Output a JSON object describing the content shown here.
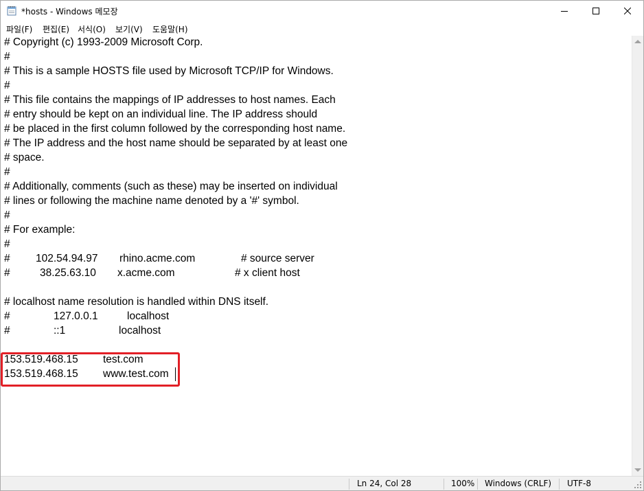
{
  "window": {
    "title": "*hosts - Windows 메모장"
  },
  "menu": [
    "파일(F)",
    "편집(E)",
    "서식(O)",
    "보기(V)",
    "도움말(H)"
  ],
  "editor": {
    "lines": [
      [
        "# Copyright (c) 1993-2009 Microsoft Corp."
      ],
      [
        "#"
      ],
      [
        "# This is a sample HOSTS file used by Microsoft TCP/IP for Windows."
      ],
      [
        "#"
      ],
      [
        "# This file contains the mappings of IP addresses to host names. Each"
      ],
      [
        "# entry should be kept on an individual line. The IP address should"
      ],
      [
        "# be placed in the first column followed by the corresponding host name."
      ],
      [
        "# The IP address and the host name should be separated by at least one"
      ],
      [
        "# space."
      ],
      [
        "#"
      ],
      [
        "# Additionally, comments (such as these) may be inserted on individual"
      ],
      [
        "# lines or following the machine name denoted by a '#' symbol."
      ],
      [
        "#"
      ],
      [
        "# For example:"
      ],
      [
        "#"
      ],
      [
        "#",
        "102.54.94.97",
        "rhino.acme.com",
        "# source server"
      ],
      [
        "#",
        "38.25.63.10",
        "x.acme.com",
        "# x client host"
      ],
      [
        ""
      ],
      [
        "# localhost name resolution is handled within DNS itself."
      ],
      [
        "#",
        "127.0.0.1",
        "localhost"
      ],
      [
        "#",
        "::1",
        "localhost"
      ],
      [
        ""
      ],
      [
        "153.519.468.15",
        "test.com"
      ],
      [
        "153.519.468.15",
        "www.test.com"
      ]
    ]
  },
  "status": {
    "position": "Ln 24, Col 28",
    "zoom": "100%",
    "line_ending": "Windows (CRLF)",
    "encoding": "UTF-8"
  },
  "colors": {
    "highlight_border": "#e21f26"
  }
}
